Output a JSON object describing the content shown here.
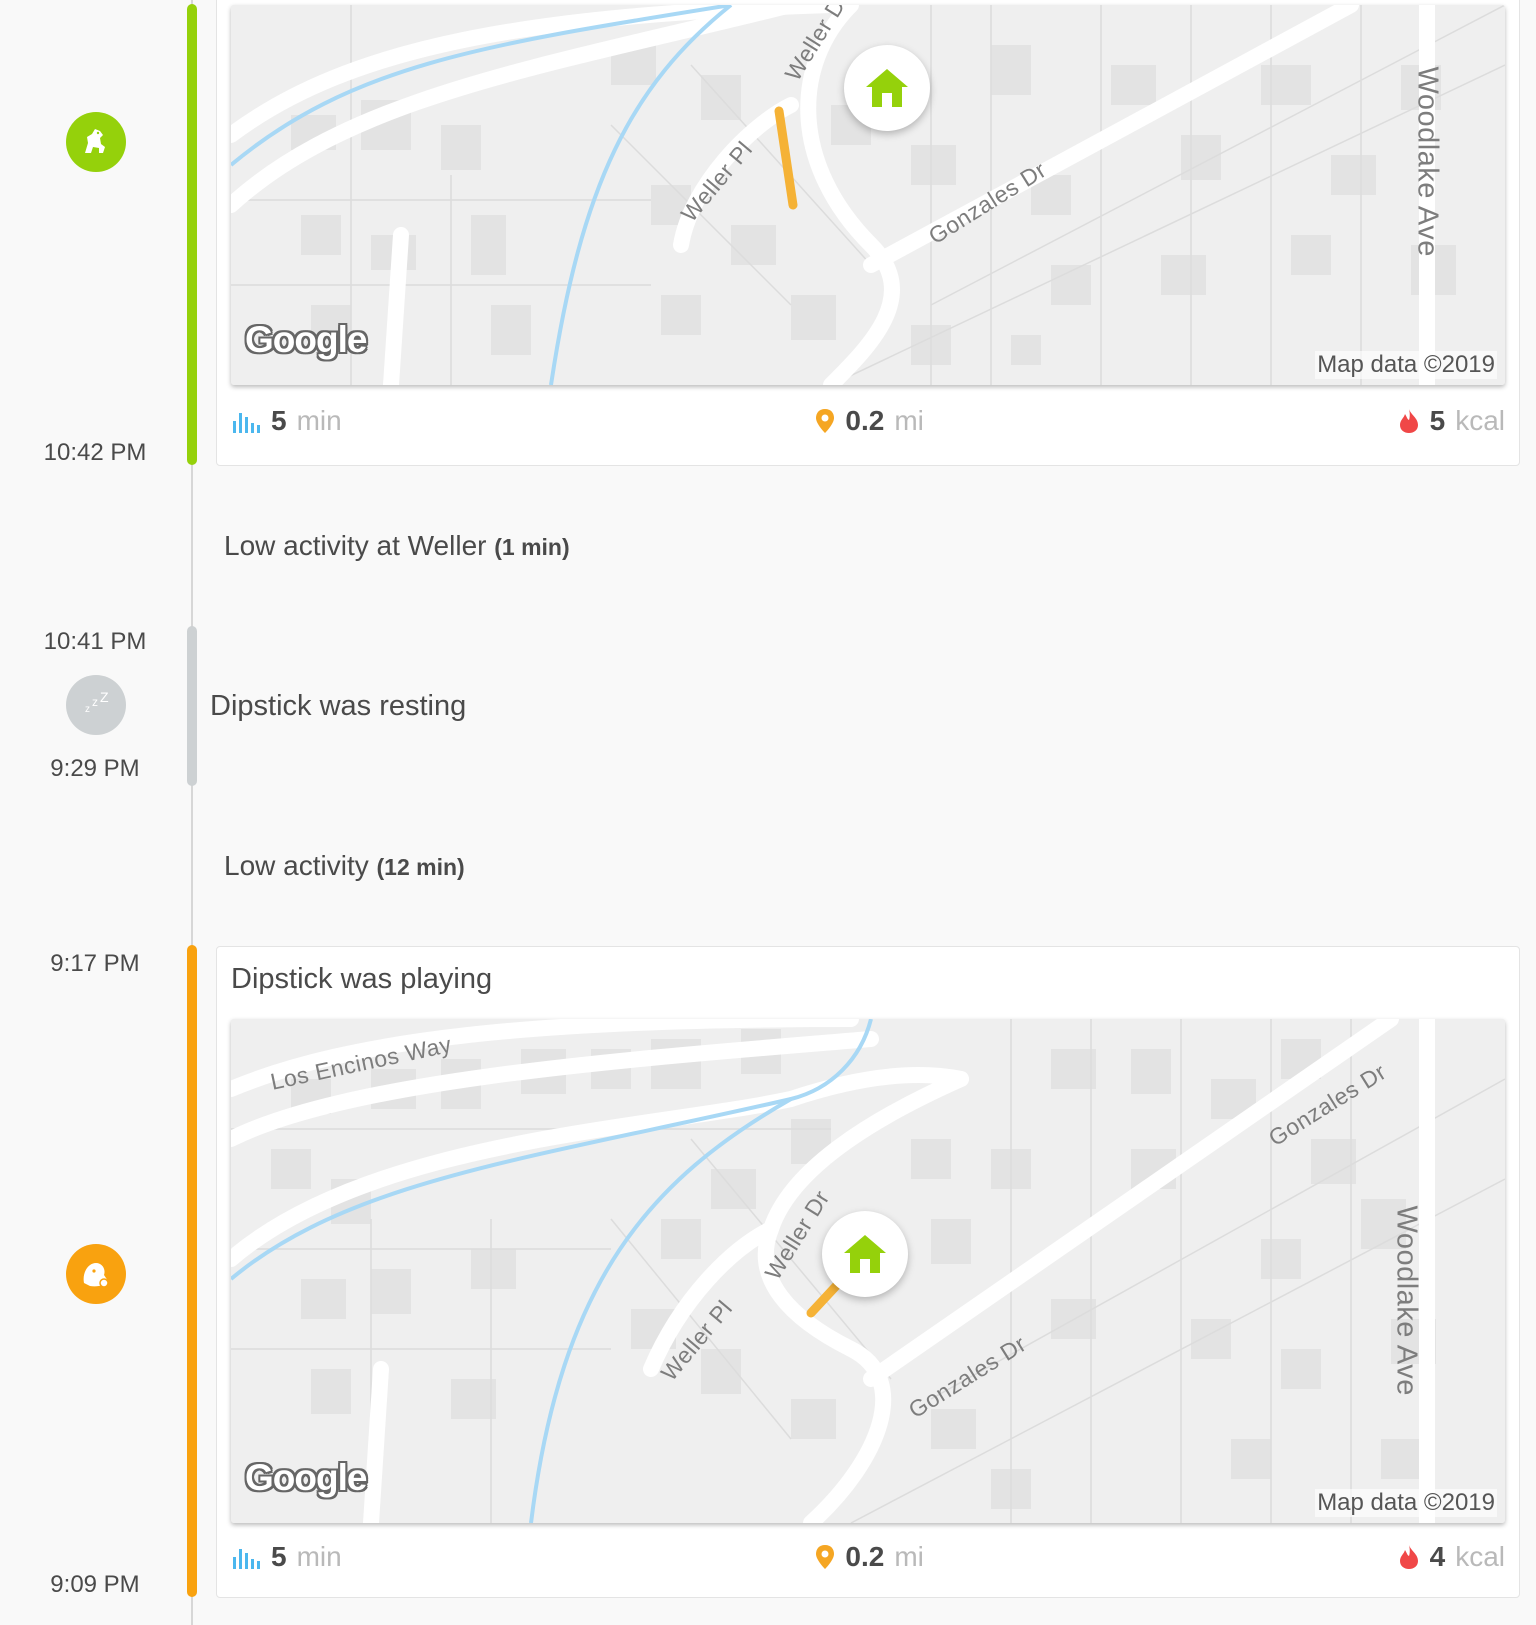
{
  "colors": {
    "walk_green": "#95d10b",
    "play_orange": "#f9a20f",
    "rest_gray": "#cdd1d3",
    "route_orange": "#f5b236",
    "water_blue": "#a8d8f5",
    "stat_blue": "#4bb7ee",
    "stat_orange": "#f5a623",
    "stat_red": "#f04747"
  },
  "walk": {
    "end_time": "10:42 PM",
    "icon": "dog-walking-icon",
    "map": {
      "labels": [
        "Weller Dr",
        "Weller Pl",
        "Gonzales Dr",
        "Woodlake Ave"
      ],
      "google": "Google",
      "map_data": "Map data ©2019"
    },
    "stats": {
      "duration": "5",
      "duration_unit": "min",
      "distance": "0.2",
      "distance_unit": "mi",
      "calories": "5",
      "calories_unit": "kcal"
    }
  },
  "low_activity_1": {
    "text": "Low activity at Weller",
    "duration": "(1 min)"
  },
  "rest": {
    "start_time": "10:41 PM",
    "end_time": "9:29 PM",
    "icon": "zzz-sleep-icon",
    "label": "Dipstick was resting"
  },
  "low_activity_2": {
    "text": "Low activity",
    "duration": "(12 min)"
  },
  "play": {
    "start_time": "9:17 PM",
    "end_time": "9:09 PM",
    "icon": "ball-play-icon",
    "title": "Dipstick was playing",
    "map": {
      "labels": [
        "Los Encinos Way",
        "Weller Dr",
        "Weller Pl",
        "Gonzales Dr",
        "Gonzales Dr",
        "Woodlake Ave"
      ],
      "google": "Google",
      "map_data": "Map data ©2019"
    },
    "stats": {
      "duration": "5",
      "duration_unit": "min",
      "distance": "0.2",
      "distance_unit": "mi",
      "calories": "4",
      "calories_unit": "kcal"
    }
  }
}
